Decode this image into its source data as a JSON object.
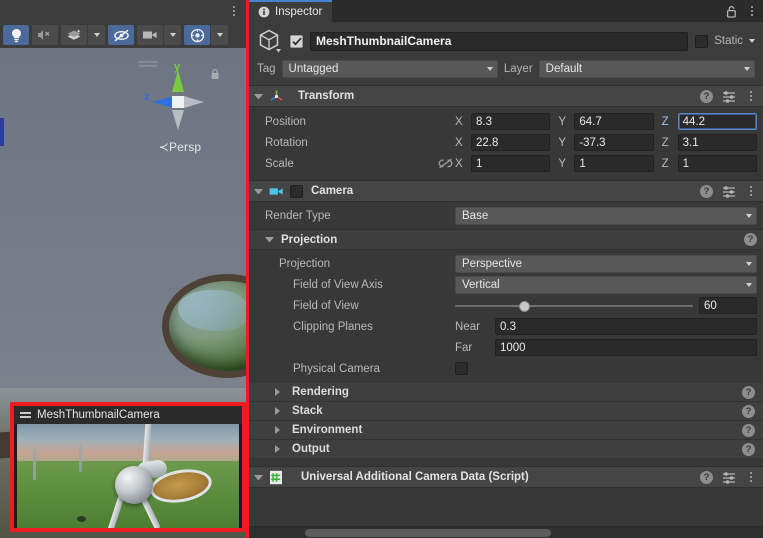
{
  "scene_view": {
    "kebab_icon": "kebab-menu-icon",
    "toolbar": [
      {
        "name": "scene-lighting-toggle",
        "icon": "lightbulb-icon",
        "active": true
      },
      {
        "name": "scene-audio-toggle",
        "icon": "audio-muted-icon",
        "active": false
      },
      {
        "name": "scene-fx-toggle",
        "icon": "effects-icon",
        "active": false,
        "dropdown": true
      },
      {
        "name": "scene-hidden-objects-toggle",
        "icon": "eye-slash-icon",
        "active": true
      },
      {
        "name": "scene-camera-toggle",
        "icon": "camera-icon",
        "active": false,
        "dropdown": true
      },
      {
        "name": "scene-gizmos-toggle",
        "icon": "gizmos-globe-icon",
        "active": true,
        "dropdown": true
      }
    ],
    "gizmo": {
      "axis_y_label": "y",
      "axis_z_label": "z",
      "projection_label": "Persp",
      "lock_icon": "lock-icon",
      "y_axis_color": "#7ac943",
      "z_axis_color": "#2f6fe0"
    },
    "camera_preview": {
      "title": "MeshThumbnailCamera",
      "grip_icon": "drag-grip-icon",
      "highlight_color": "#ef1b20"
    }
  },
  "inspector": {
    "tab": {
      "label": "Inspector",
      "icon": "info-circle-icon"
    },
    "lock_icon": "padlock-open-icon",
    "kebab_icon": "kebab-menu-icon",
    "accent_color": "#4b7fd1",
    "object_header": {
      "prefab_icon": "cube-icon",
      "enabled_checkbox": true,
      "name": "MeshThumbnailCamera",
      "static_label": "Static",
      "static_checked": false,
      "static_dropdown_icon": "chevron-down-icon",
      "tag_label": "Tag",
      "tag_value": "Untagged",
      "layer_label": "Layer",
      "layer_value": "Default"
    },
    "transform": {
      "title": "Transform",
      "icon": "transform-axis-icon",
      "expanded": true,
      "help_icon": "help-icon",
      "preset_icon": "preset-settings-icon",
      "kebab_icon": "kebab-menu-icon",
      "rows": [
        {
          "label": "Position",
          "x": "8.3",
          "y": "64.7",
          "z": "44.2",
          "z_focused": true
        },
        {
          "label": "Rotation",
          "x": "22.8",
          "y": "-37.3",
          "z": "3.1",
          "z_focused": false
        },
        {
          "label": "Scale",
          "x": "1",
          "y": "1",
          "z": "1",
          "z_focused": false,
          "lock_icon": "constrain-proportions-off-icon"
        }
      ],
      "axis_labels": {
        "x": "X",
        "y": "Y",
        "z": "Z"
      }
    },
    "camera": {
      "title": "Camera",
      "icon": "camera-icon",
      "icon_color": "#4ec3e8",
      "enabled_checkbox": false,
      "expanded": true,
      "help_icon": "help-icon",
      "preset_icon": "preset-settings-icon",
      "kebab_icon": "kebab-menu-icon",
      "render_type": {
        "label": "Render Type",
        "value": "Base"
      },
      "projection_section": {
        "title": "Projection",
        "expanded": true,
        "help_icon": "help-icon",
        "projection": {
          "label": "Projection",
          "value": "Perspective"
        },
        "fov_axis": {
          "label": "Field of View Axis",
          "value": "Vertical"
        },
        "fov": {
          "label": "Field of View",
          "value": "60",
          "slider_percent": 29
        },
        "clipping_planes": {
          "label": "Clipping Planes",
          "near_label": "Near",
          "near_value": "0.3",
          "far_label": "Far",
          "far_value": "1000"
        },
        "physical_camera": {
          "label": "Physical Camera",
          "checked": false
        }
      },
      "collapsed_sections": [
        {
          "label": "Rendering",
          "help_icon": "help-icon"
        },
        {
          "label": "Stack",
          "help_icon": "help-icon"
        },
        {
          "label": "Environment",
          "help_icon": "help-icon"
        },
        {
          "label": "Output",
          "help_icon": "help-icon"
        }
      ]
    },
    "script_component": {
      "title": "Universal Additional Camera Data (Script)",
      "icon": "csharp-script-icon",
      "icon_color": "#4ec94e",
      "expanded": true,
      "help_icon": "help-icon",
      "preset_icon": "preset-settings-icon",
      "kebab_icon": "kebab-menu-icon"
    },
    "scrollbar": {
      "name": "horizontal-scrollbar"
    }
  }
}
